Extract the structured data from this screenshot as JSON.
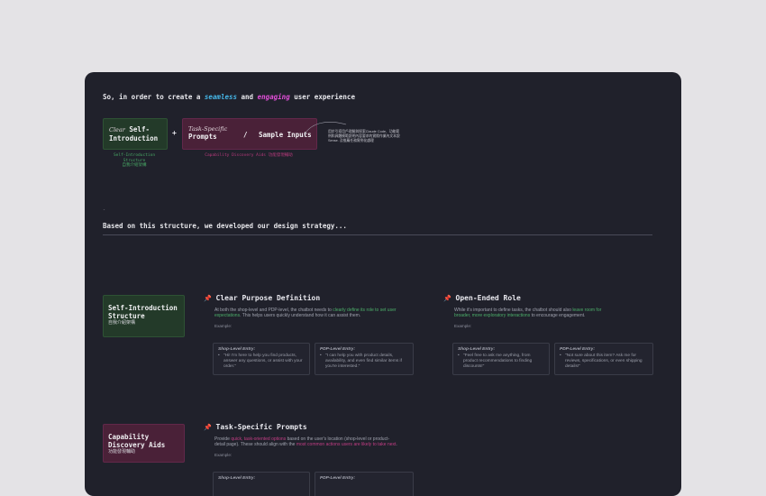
{
  "headline": {
    "prefix": "So, in order to create a ",
    "word_a": "seamless",
    "middle": " and ",
    "word_b": "engaging",
    "suffix": " user experience"
  },
  "diagram": {
    "box1": {
      "script": "Clear",
      "title_line1": "Self-",
      "title_line2": "Introduction"
    },
    "plus": "+",
    "box2": {
      "script": "Task-Specific",
      "title": "Prompts",
      "slash": "/",
      "sample": "Sample Inputs"
    },
    "caption1": {
      "line1": "Self-Introduction",
      "line2": "Structure",
      "line3": "自我介紹架構"
    },
    "caption2": "Capability Discovery Aids 功能發現輔助",
    "note": {
      "line1": "用於引導用戶理解與探索Claude Code、功能範",
      "line2": "例和具體模範說明內容要求的實際作業內文本說",
      "line3": "Sense. 及推薦任務實例化處理"
    }
  },
  "dash": "-",
  "strategy_line": "Based on this structure, we developed our design strategy...",
  "sections": {
    "s1": {
      "line1": "Self-Introduction",
      "line2": "Structure",
      "sub": "自我介紹架構"
    },
    "s2": {
      "line1": "Capability",
      "line2": "Discovery Aids",
      "sub": "功能發現輔助"
    }
  },
  "cards": {
    "clear_purpose": {
      "icon": "📌",
      "title": "Clear Purpose Definition",
      "body_a": "At both the shop-level and PDP-level, the chatbot needs to ",
      "body_em": "clearly define its role to set user expectations",
      "body_b": ". This helps users quickly understand how it can assist them.",
      "example_label": "Example:",
      "ex1_head": "Shop-Level Entry:",
      "ex1_text": "\"Hi! I'm here to help you find products, answer any questions, or assist with your order.\"",
      "ex2_head": "PDP-Level Entry:",
      "ex2_text": "\"I can help you with product details, availability, and even find similar items if you're interested.\""
    },
    "open_ended": {
      "icon": "📌",
      "title": "Open-Ended Role",
      "body_a": "While it's important to define tasks, the chatbot should also ",
      "body_em": "leave room for broader, more exploratory interactions",
      "body_b": " to encourage engagement.",
      "example_label": "Example:",
      "ex1_head": "Shop-Level Entry:",
      "ex1_text": "\"Feel free to ask me anything, from product recommendations to finding discounts!\"",
      "ex2_head": "PDP-Level Entry:",
      "ex2_text": "\"Not sure about this item? Ask me for reviews, specifications, or even shipping details!\""
    },
    "task_specific": {
      "icon": "📌",
      "title": "Task-Specific Prompts",
      "body_a": "Provide ",
      "body_em": "quick, task-oriented options",
      "body_b": " based on the user's location (shop-level or product-detail page). These should align with the ",
      "body_em2": "most common actions users are likely to take next",
      "body_c": ".",
      "example_label": "Example:",
      "ex1_head": "Shop-Level Entry:",
      "ex2_head": "PDP-Level Entry:"
    }
  },
  "colors": {
    "accent_blue": "#46b7e8",
    "accent_magenta": "#e14fd8",
    "green_box": "#233a29",
    "maroon_box": "#4a2138",
    "panel": "#20212b"
  }
}
